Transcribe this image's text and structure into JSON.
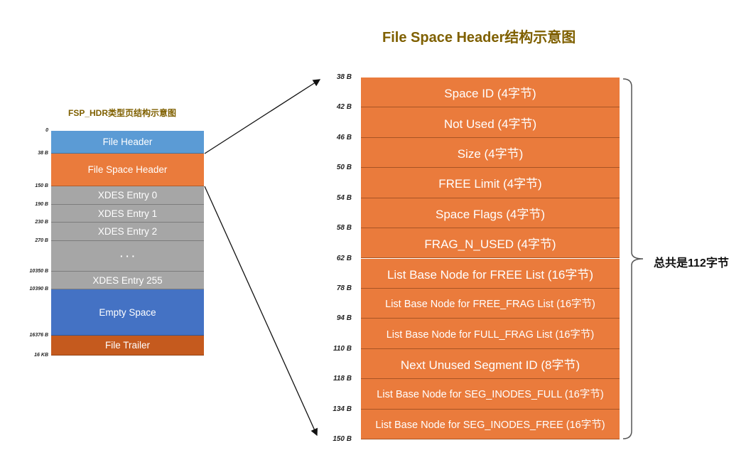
{
  "main_title": "File Space Header结构示意图",
  "sub_title": "FSP_HDR类型页结构示意图",
  "colors": {
    "title": "#7f6000",
    "file_header": "#5b9bd5",
    "space_header": "#ea7b3c",
    "xdes": "#a6a6a6",
    "empty": "#4472c4",
    "trailer": "#c55a1e"
  },
  "left_blocks": [
    {
      "label": "File Header",
      "offset": "0",
      "color": "#5b9bd5"
    },
    {
      "label": "File Space Header",
      "offset": "38 B",
      "color": "#ea7b3c"
    },
    {
      "label": "XDES Entry 0",
      "offset": "150 B",
      "color": "#a6a6a6"
    },
    {
      "label": "XDES Entry 1",
      "offset": "190 B",
      "color": "#a6a6a6"
    },
    {
      "label": "XDES Entry 2",
      "offset": "230 B",
      "color": "#a6a6a6"
    },
    {
      "label": "· · ·",
      "offset": "270 B",
      "color": "#a6a6a6"
    },
    {
      "label": "XDES Entry 255",
      "offset": "10350 B",
      "color": "#a6a6a6"
    },
    {
      "label": "Empty Space",
      "offset": "10390 B",
      "color": "#4472c4"
    },
    {
      "label": "File Trailer",
      "offset": "16376 B",
      "color": "#c55a1e"
    }
  ],
  "left_end_offset": "16 KB",
  "right_blocks": [
    {
      "label": "Space ID (4字节)",
      "offset": "38 B"
    },
    {
      "label": "Not Used (4字节)",
      "offset": "42 B"
    },
    {
      "label": "Size (4字节)",
      "offset": "46 B"
    },
    {
      "label": "FREE Limit (4字节)",
      "offset": "50 B"
    },
    {
      "label": "Space Flags (4字节)",
      "offset": "54 B"
    },
    {
      "label": "FRAG_N_USED (4字节)",
      "offset": "58 B"
    },
    {
      "label": "List Base Node for FREE List (16字节)",
      "offset": "62 B"
    },
    {
      "label": "List Base Node for FREE_FRAG List (16字节)",
      "offset": "78 B",
      "small": true
    },
    {
      "label": "List Base Node for FULL_FRAG List (16字节)",
      "offset": "94 B",
      "small": true
    },
    {
      "label": "Next Unused Segment ID  (8字节)",
      "offset": "110 B"
    },
    {
      "label": "List Base Node for SEG_INODES_FULL (16字节)",
      "offset": "118 B",
      "small": true
    },
    {
      "label": "List Base Node for SEG_INODES_FREE (16字节)",
      "offset": "134 B",
      "small": true
    }
  ],
  "right_end_offset": "150 B",
  "total_label": "总共是112字节"
}
